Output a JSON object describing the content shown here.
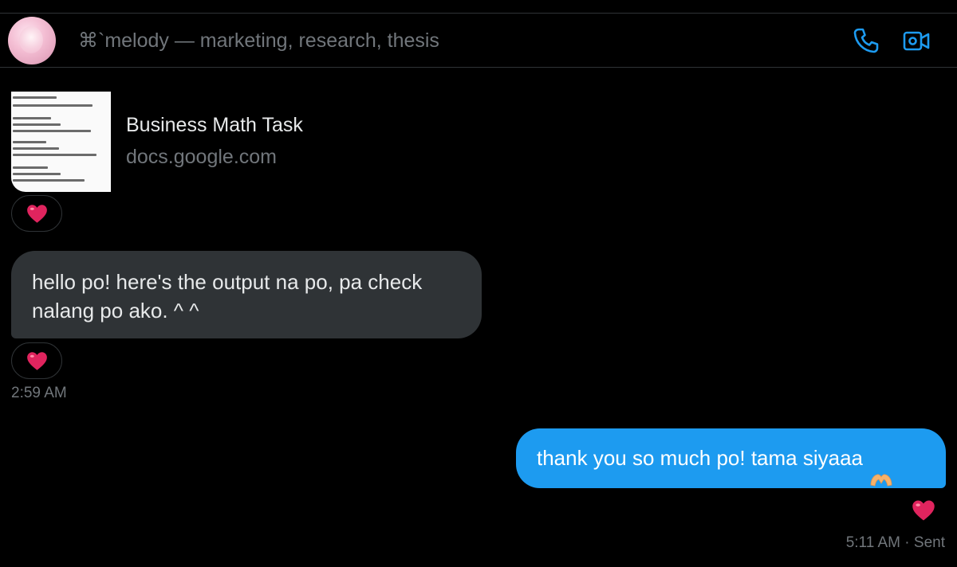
{
  "header": {
    "title": "⌘`melody — marketing, research, thesis",
    "avatar_icon": "avatar",
    "call_icon": "phone-icon",
    "video_icon": "video-call-icon",
    "accent_color": "#1d9bf0"
  },
  "messages": [
    {
      "type": "link_card",
      "direction": "incoming",
      "title": "Business Math Task",
      "domain": "docs.google.com",
      "reaction": "❤️"
    },
    {
      "type": "text",
      "direction": "incoming",
      "text": "hello po! here's the output na po, pa check nalang po ako. ^ ^",
      "reaction": "❤️",
      "time": "2:59 AM"
    },
    {
      "type": "text",
      "direction": "outgoing",
      "text": "thank you so much po! tama siyaaa",
      "emoji_icon": "heart-hands-icon",
      "reaction": "❤️",
      "time": "5:11 AM",
      "separator": "·",
      "status": "Sent"
    }
  ],
  "colors": {
    "background": "#000000",
    "incoming_bubble": "#2f3336",
    "outgoing_bubble": "#1d9bf0",
    "muted_text": "#71767b",
    "heart": "#e0245e"
  }
}
